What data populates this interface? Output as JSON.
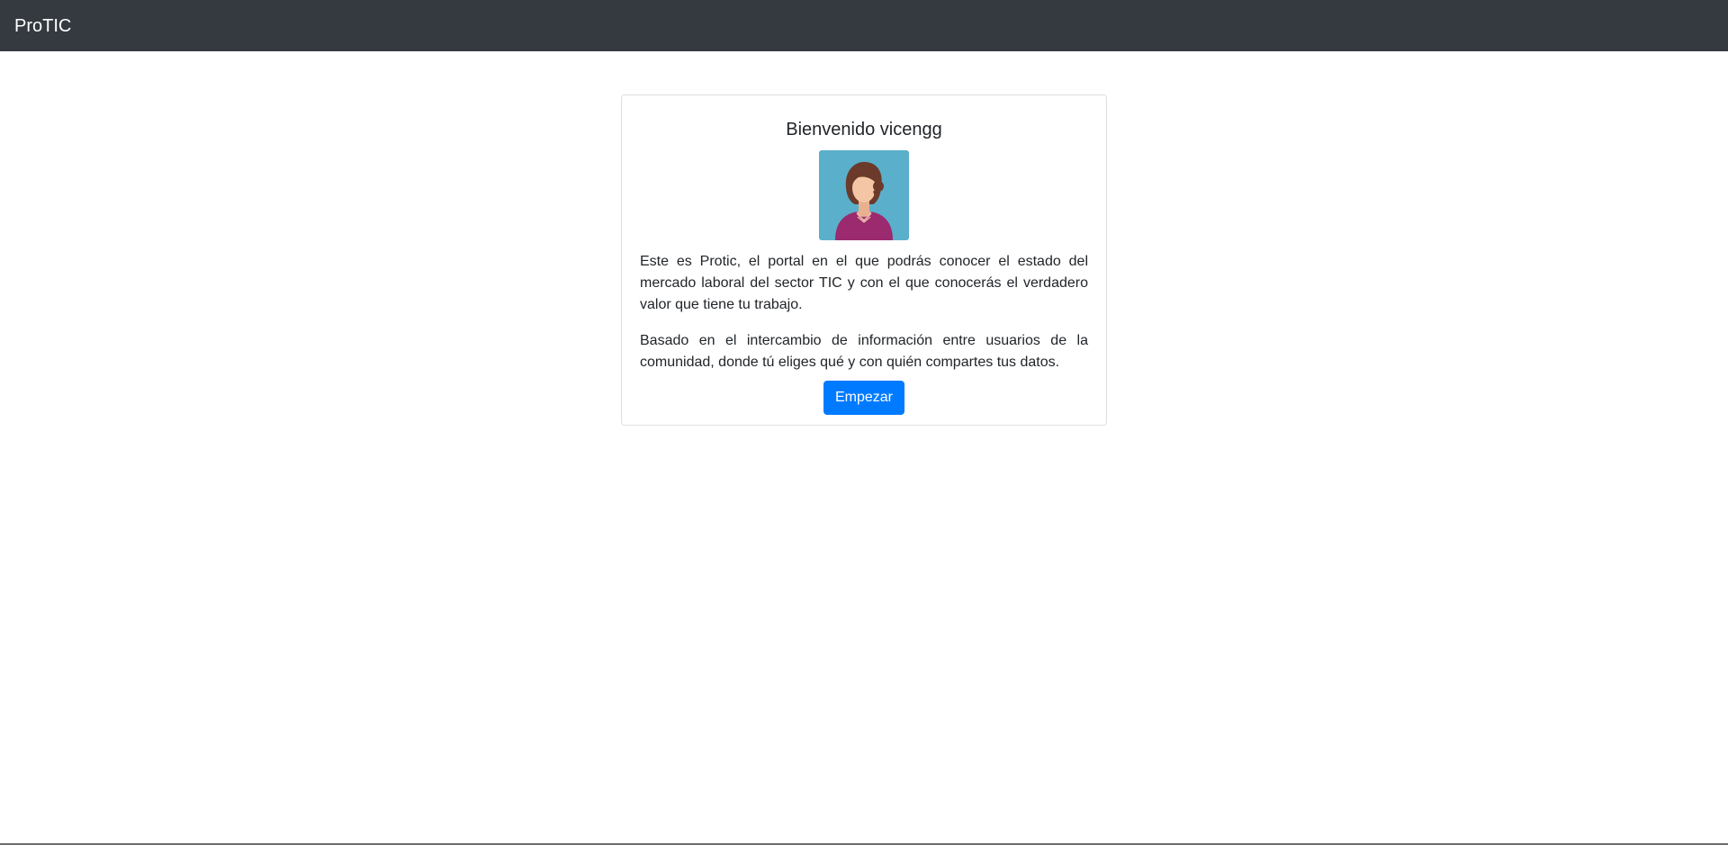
{
  "navbar": {
    "brand": "ProTIC"
  },
  "card": {
    "title": "Bienvenido vicengg",
    "avatar_icon": "woman-avatar-icon",
    "paragraph_1": "Este es Protic, el portal en el que podrás conocer el estado del mercado laboral del sector TIC y con el que conocerás el verdadero valor que tiene tu trabajo.",
    "paragraph_2": "Basado en el intercambio de información entre usuarios de la comunidad, donde tú eliges qué y con quién compartes tus datos.",
    "button_label": "Empezar"
  },
  "colors": {
    "navbar_bg": "#343a40",
    "primary": "#007bff",
    "avatar_bg": "#5aafcb",
    "shirt": "#9b2a6f",
    "hair": "#6b3a2a",
    "skin": "#f5c6a5"
  }
}
